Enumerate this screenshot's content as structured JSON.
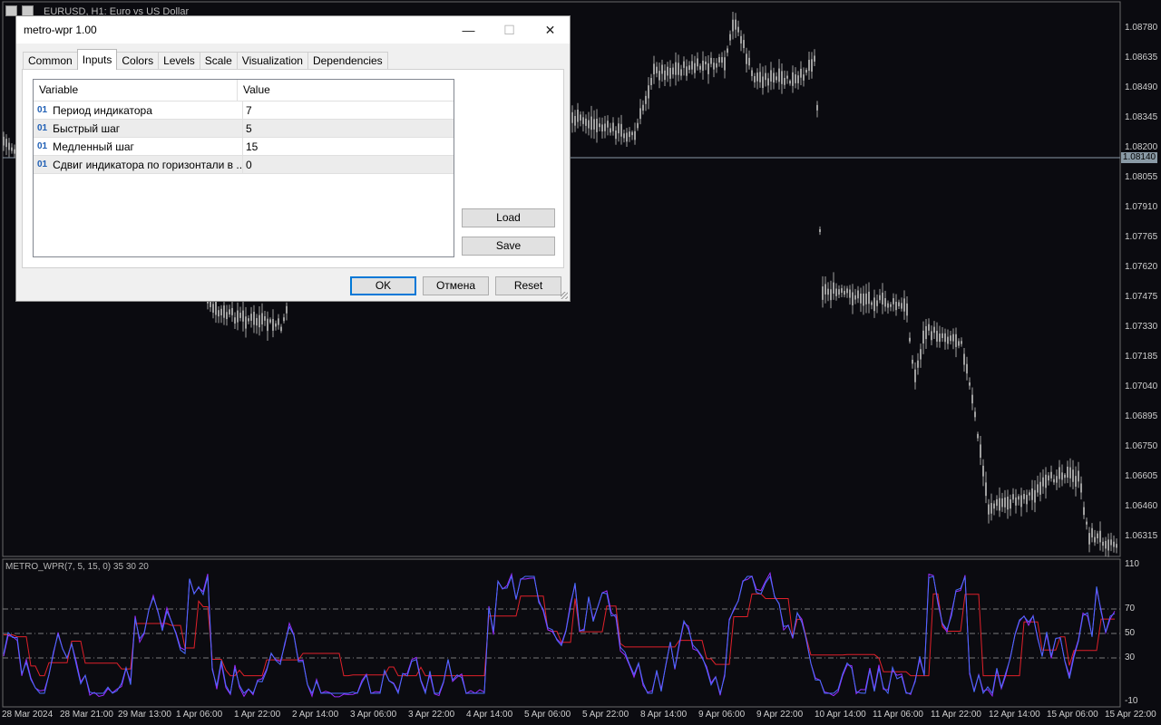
{
  "chart": {
    "title": "EURUSD, H1:  Euro vs US Dollar",
    "price_labels": [
      "1.08780",
      "1.08635",
      "1.08490",
      "1.08345",
      "1.08200",
      "1.08055",
      "1.07910",
      "1.07765",
      "1.07620",
      "1.07475",
      "1.07330",
      "1.07185",
      "1.07040",
      "1.06895",
      "1.06750",
      "1.06605",
      "1.06460",
      "1.06315"
    ],
    "current_price": "1.08140",
    "indicator_label": "METRO_WPR(7, 5, 15, 0) 35 30 20",
    "osc_labels": [
      "110",
      "70",
      "50",
      "30",
      "-10"
    ],
    "time_labels": [
      "28 Mar 2024",
      "28 Mar 21:00",
      "29 Mar 13:00",
      "1 Apr 06:00",
      "1 Apr 22:00",
      "2 Apr 14:00",
      "3 Apr 06:00",
      "3 Apr 22:00",
      "4 Apr 14:00",
      "5 Apr 06:00",
      "5 Apr 22:00",
      "8 Apr 14:00",
      "9 Apr 06:00",
      "9 Apr 22:00",
      "10 Apr 14:00",
      "11 Apr 06:00",
      "11 Apr 22:00",
      "12 Apr 14:00",
      "15 Apr 06:00",
      "15 Apr 22:00"
    ],
    "colors": {
      "background": "#0b0b10",
      "candles": "#a0a0a0",
      "wpr_fast": "#4a6cff",
      "wpr_slow": "#9a2cff",
      "signal": "#e0202a",
      "grid": "#7a7a7a"
    }
  },
  "dialog": {
    "title": "metro-wpr 1.00",
    "window_buttons": {
      "minimize": "—",
      "maximize": "☐",
      "close": "✕"
    },
    "tabs": [
      {
        "label": "Common",
        "active": false
      },
      {
        "label": "Inputs",
        "active": true
      },
      {
        "label": "Colors",
        "active": false
      },
      {
        "label": "Levels",
        "active": false
      },
      {
        "label": "Scale",
        "active": false
      },
      {
        "label": "Visualization",
        "active": false
      },
      {
        "label": "Dependencies",
        "active": false
      }
    ],
    "grid": {
      "headers": {
        "variable": "Variable",
        "value": "Value"
      },
      "rows": [
        {
          "icon": "01",
          "variable": "Период индикатора",
          "value": "7"
        },
        {
          "icon": "01",
          "variable": "Быстрый шаг",
          "value": "5"
        },
        {
          "icon": "01",
          "variable": "Медленный шаг",
          "value": "15"
        },
        {
          "icon": "01",
          "variable": "Сдвиг индикатора по горизонтали в ...",
          "value": "0"
        }
      ]
    },
    "buttons": {
      "load": "Load",
      "save": "Save",
      "ok": "OK",
      "cancel": "Отмена",
      "reset": "Reset"
    }
  }
}
